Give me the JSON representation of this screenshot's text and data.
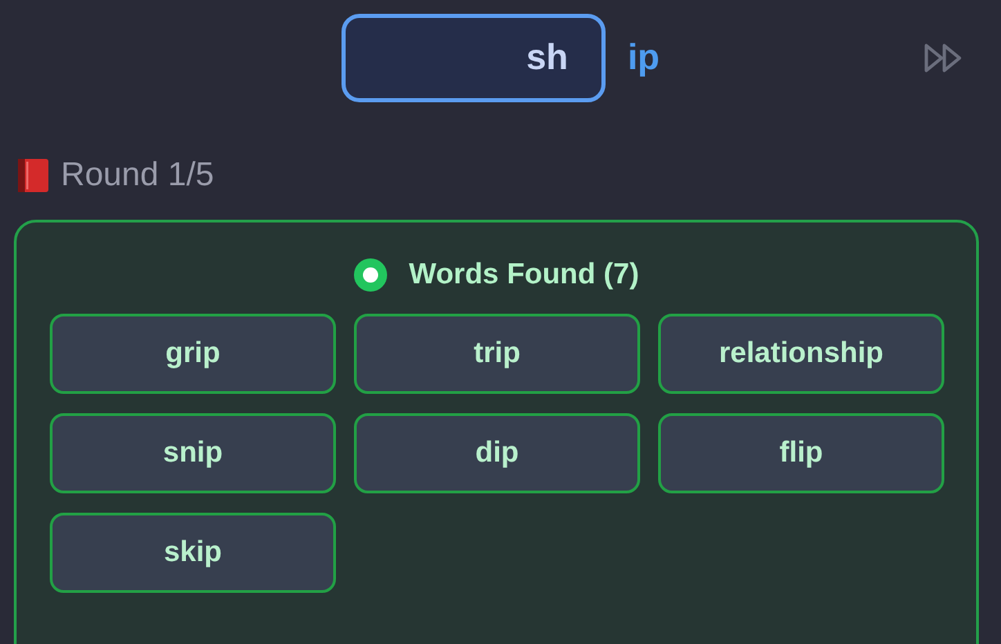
{
  "answer": {
    "value": "sh",
    "suffix": "ip"
  },
  "round": {
    "label": "Round 1/5"
  },
  "found": {
    "title": "Words Found (7)",
    "words": [
      "grip",
      "trip",
      "relationship",
      "snip",
      "dip",
      "flip",
      "skip"
    ]
  }
}
